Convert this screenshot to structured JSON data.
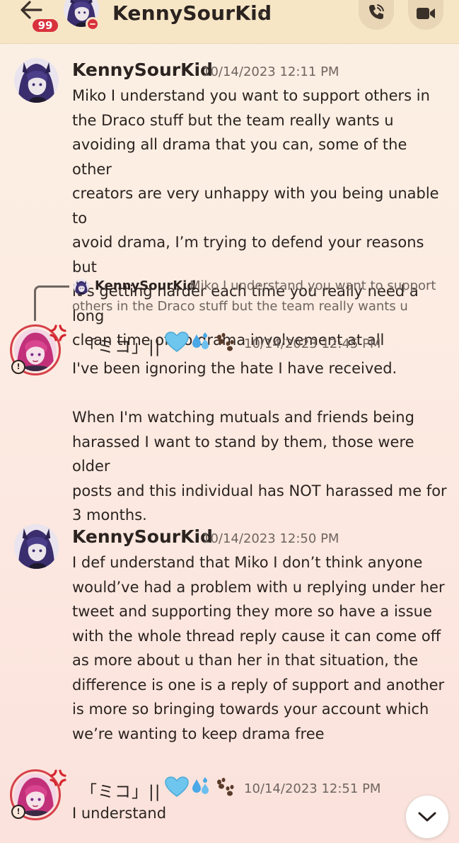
{
  "header": {
    "badge_count": "99",
    "title": "KennySourKid",
    "chevron": "›",
    "icons": {
      "back": "arrow-left-icon",
      "call": "phone-call-icon",
      "video": "video-camera-icon"
    },
    "status": "do-not-disturb"
  },
  "reply_preview": {
    "author": "KennySourKid",
    "text_line1": "Miko I understand you want to support",
    "text_line2": "others in the Draco stuff but the team really wants u"
  },
  "messages": [
    {
      "author": "KennySourKid",
      "timestamp": "10/14/2023 12:11 PM",
      "text": "Miko I understand you want to support others in\nthe Draco stuff but the team really wants u\navoiding all drama that you can, some of the other\ncreators are very unhappy with you being unable to\navoid drama, I’m trying to defend your reasons but\nit’s getting harder each time you really need a long\nclean time of no drama involvement at all"
    },
    {
      "author": "「ミコ」||",
      "author_emojis": [
        "light-blue-heart",
        "sweat-droplets",
        "paw-prints"
      ],
      "timestamp": "10/14/2023 12:45 PM",
      "text": "I've been ignoring the hate I have received.\n\nWhen I'm watching mutuals and friends being\nharassed I want to stand by them, those were older\nposts and this individual has NOT harassed me for\n3 months."
    },
    {
      "author": "KennySourKid",
      "timestamp": "10/14/2023 12:50 PM",
      "text": "I def understand that Miko I don’t think anyone\nwould’ve had a problem with u replying under her\ntweet and supporting they more so have a issue\nwith the whole thread reply cause it can come off\nas more about u than her in that situation, the\ndifference is one is a reply of support and another\nis more so bringing towards your account which\nwe’re wanting to keep drama free"
    },
    {
      "author": "「ミコ」||",
      "author_emojis": [
        "light-blue-heart",
        "sweat-droplets",
        "paw-prints"
      ],
      "timestamp": "10/14/2023 12:51 PM",
      "text": "I understand"
    }
  ],
  "scroll_button_icon": "chevron-down-icon",
  "colors": {
    "header_bg": "#f7e6c6",
    "badge": "#d8323c",
    "ring": "#d6414a",
    "text": "#2b2320",
    "muted": "#6f6560"
  }
}
